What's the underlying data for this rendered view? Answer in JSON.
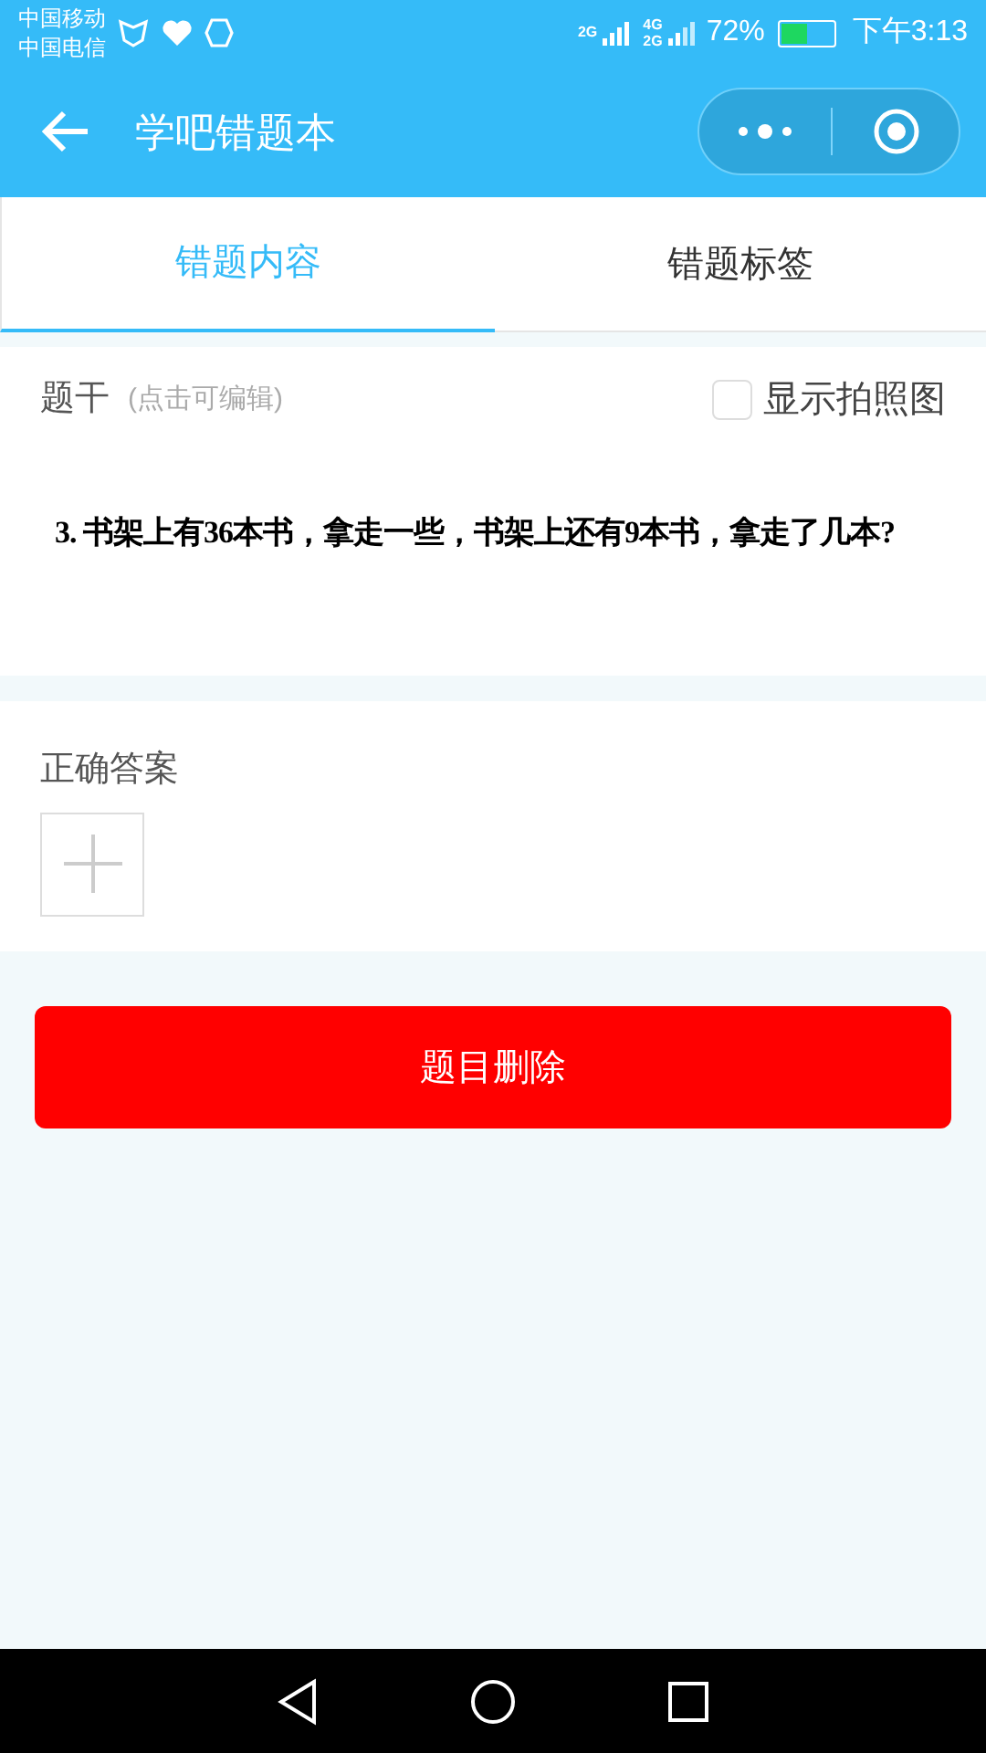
{
  "status_bar": {
    "carriers": [
      "中国移动",
      "中国电信"
    ],
    "network_1": "2G",
    "network_2_top": "4G",
    "network_2_bottom": "2G",
    "battery_percent": "72%",
    "battery": {
      "level": 0.5
    },
    "time": "下午3:13"
  },
  "header": {
    "title": "学吧错题本"
  },
  "tabs": [
    {
      "label": "错题内容",
      "selected": true
    },
    {
      "label": "错题标签",
      "selected": false
    }
  ],
  "stem": {
    "label": "题干",
    "hint": "(点击可编辑)",
    "show_photo": {
      "label": "显示拍照图",
      "checked": false
    },
    "question": "3. 书架上有36本书，拿走一些，书架上还有9本书，拿走了几本?"
  },
  "answer": {
    "label": "正确答案"
  },
  "delete_button": "题目删除"
}
